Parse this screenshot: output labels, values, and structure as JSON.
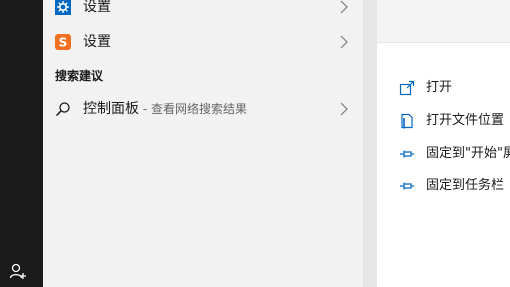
{
  "search_results": [
    {
      "label": "设置",
      "icon": "settings-gear-icon"
    },
    {
      "label": "设置",
      "icon": "sogou-s-icon"
    }
  ],
  "suggestions_header": "搜索建议",
  "suggestion": {
    "label": "控制面板",
    "sub": " - 查看网络搜索结果",
    "icon": "search-icon"
  },
  "actions": [
    {
      "label": "打开",
      "icon": "open-icon"
    },
    {
      "label": "打开文件位置",
      "icon": "file-location-icon"
    },
    {
      "label": "固定到\"开始\"屏",
      "icon": "pin-icon"
    },
    {
      "label": "固定到任务栏",
      "icon": "pin-icon"
    }
  ],
  "accent_color": "#0067c0",
  "sogou_color": "#f36f21"
}
